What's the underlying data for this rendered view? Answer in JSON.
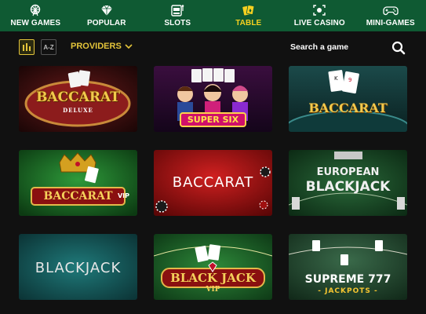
{
  "nav": {
    "items": [
      {
        "label": "NEW GAMES",
        "icon": "ferris-wheel-icon"
      },
      {
        "label": "POPULAR",
        "icon": "diamond-icon"
      },
      {
        "label": "SLOTS",
        "icon": "slot-machine-icon"
      },
      {
        "label": "TABLE",
        "icon": "cards-icon",
        "active": true
      },
      {
        "label": "LIVE CASINO",
        "icon": "live-camera-icon"
      },
      {
        "label": "MINI-GAMES",
        "icon": "gamepad-icon"
      }
    ],
    "active_color": "#f5d020",
    "background": "#0f5a33"
  },
  "toolbar": {
    "az_label": "A-Z",
    "providers_label": "PROVIDERS",
    "search_placeholder": "Search a game"
  },
  "games": [
    {
      "title": "BACCARAT",
      "subtitle": "DELUXE"
    },
    {
      "title": "SUPER SIX",
      "subtitle": ""
    },
    {
      "title": "BACCARAT",
      "subtitle": ""
    },
    {
      "title": "BACCARAT",
      "subtitle": "VIP"
    },
    {
      "title": "BACCARAT",
      "subtitle": ""
    },
    {
      "title": "EUROPEAN",
      "subtitle": "BLACKJACK"
    },
    {
      "title": "BLACKJACK",
      "subtitle": ""
    },
    {
      "title": "BLACK JACK",
      "subtitle": "VIP"
    },
    {
      "title": "SUPREME 777",
      "subtitle": "- JACKPOTS -"
    }
  ]
}
